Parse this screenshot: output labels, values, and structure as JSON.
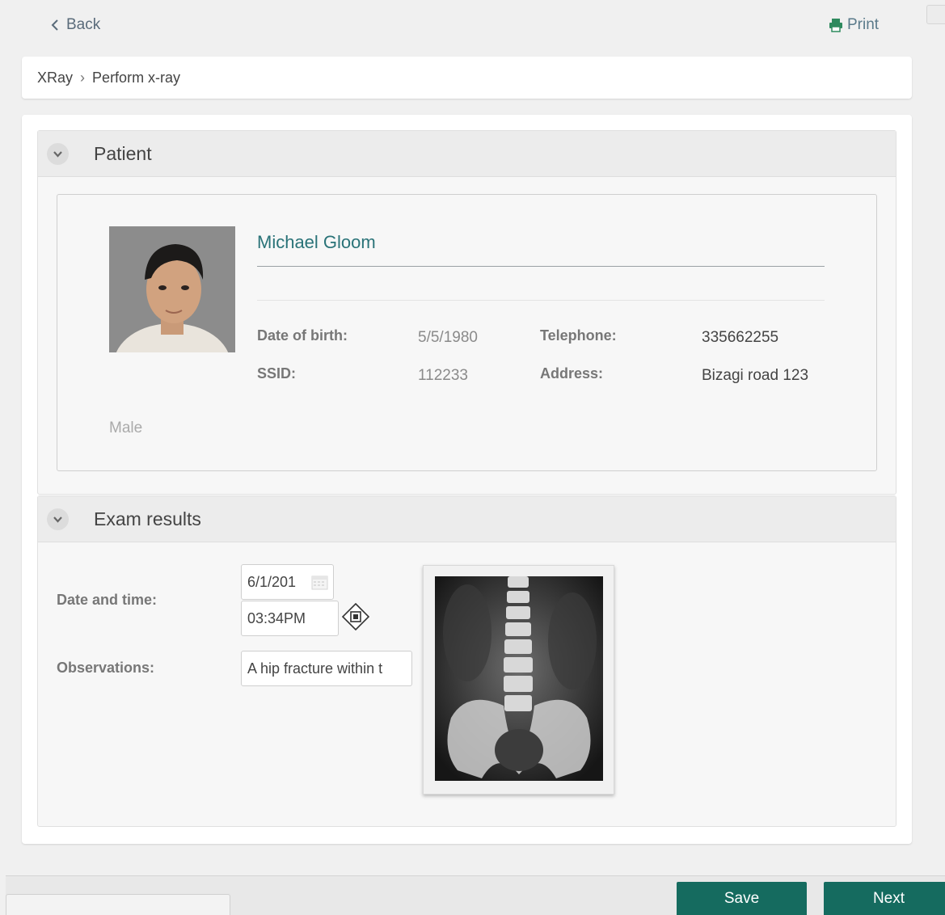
{
  "topbar": {
    "back_label": "Back",
    "print_label": "Print"
  },
  "breadcrumb": {
    "root": "XRay",
    "separator": "›",
    "current": "Perform x-ray"
  },
  "patient_section": {
    "title": "Patient",
    "name": "Michael Gloom",
    "dob_label": "Date of birth:",
    "dob_value": "5/5/1980",
    "telephone_label": "Telephone:",
    "telephone_value": "335662255",
    "ssid_label": "SSID:",
    "ssid_value": "112233",
    "address_label": "Address:",
    "address_value": "Bizagi road 123",
    "gender": "Male"
  },
  "exam_section": {
    "title": "Exam results",
    "datetime_label": "Date and time:",
    "date_value": "6/1/201",
    "time_value": "03:34PM",
    "observations_label": "Observations:",
    "observations_value": "A hip fracture within t"
  },
  "footer": {
    "save_label": "Save",
    "next_label": "Next"
  },
  "colors": {
    "accent": "#156b5f",
    "name_text": "#2a7378"
  }
}
